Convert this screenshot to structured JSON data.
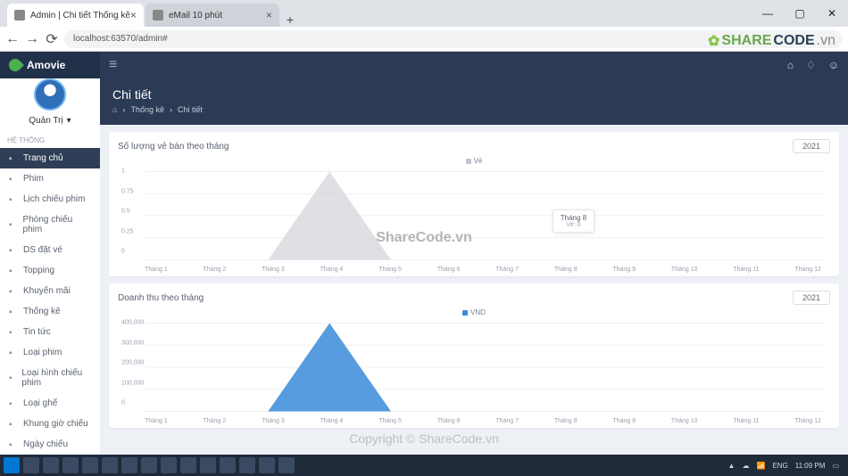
{
  "browser": {
    "tabs": [
      {
        "title": "Admin | Chi tiết Thống kê",
        "active": true
      },
      {
        "title": "eMail 10 phút",
        "active": false
      }
    ],
    "url": "localhost:63570/admin#"
  },
  "window_controls": {
    "min": "—",
    "max": "▢",
    "close": "✕"
  },
  "brand": "Amovie",
  "topbar_icons": [
    "home-icon",
    "bell-icon",
    "user-icon"
  ],
  "profile": {
    "name": "Quản Trị"
  },
  "sidebar": {
    "section": "HỆ THỐNG",
    "items": [
      {
        "label": "Trang chủ",
        "icon": "home-icon",
        "active": true
      },
      {
        "label": "Phim",
        "icon": "film-icon"
      },
      {
        "label": "Lịch chiếu phim",
        "icon": "calendar-icon"
      },
      {
        "label": "Phòng chiếu phim",
        "icon": "room-icon"
      },
      {
        "label": "DS đặt vé",
        "icon": "ticket-icon"
      },
      {
        "label": "Topping",
        "icon": "food-icon"
      },
      {
        "label": "Khuyến mãi",
        "icon": "promo-icon"
      },
      {
        "label": "Thống kê",
        "icon": "stats-icon"
      },
      {
        "label": "Tin tức",
        "icon": "news-icon"
      },
      {
        "label": "Loại phim",
        "icon": "tag-icon"
      },
      {
        "label": "Loại hình chiếu phim",
        "icon": "tag-icon"
      },
      {
        "label": "Loại ghế",
        "icon": "seat-icon"
      },
      {
        "label": "Khung giờ chiếu",
        "icon": "clock-icon"
      },
      {
        "label": "Ngày chiếu",
        "icon": "date-icon"
      }
    ]
  },
  "page": {
    "title": "Chi tiết",
    "breadcrumb": [
      "⌂",
      "Thống kê",
      "Chi tiết"
    ]
  },
  "cards": {
    "tickets": {
      "title": "Số lượng vẻ bán theo tháng",
      "year": "2021",
      "legend": "Vé"
    },
    "revenue": {
      "title": "Doanh thu theo tháng",
      "year": "2021",
      "legend": "VND"
    }
  },
  "tooltip": {
    "title": "Tháng 8",
    "value": "Vé: 0"
  },
  "watermarks": {
    "logo_a": "SHARE",
    "logo_b": "CODE",
    "logo_c": ".vn",
    "center": "ShareCode.vn",
    "bottom": "Copyright © ShareCode.vn"
  },
  "taskbar": {
    "lang": "ENG",
    "time": "11:09 PM"
  },
  "chart_data": [
    {
      "type": "area",
      "title": "Số lượng vẻ bán theo tháng",
      "series_name": "Vé",
      "categories": [
        "Tháng 1",
        "Tháng 2",
        "Tháng 3",
        "Tháng 4",
        "Tháng 5",
        "Tháng 6",
        "Tháng 7",
        "Tháng 8",
        "Tháng 9",
        "Tháng 10",
        "Tháng 11",
        "Tháng 12"
      ],
      "values": [
        0,
        0,
        0,
        1,
        0,
        0,
        0,
        0,
        0,
        0,
        0,
        0
      ],
      "yticks": [
        0,
        0.25,
        0.5,
        0.75,
        1
      ],
      "ylim": [
        0,
        1
      ],
      "color": "#c9ccd1"
    },
    {
      "type": "area",
      "title": "Doanh thu theo tháng",
      "series_name": "VND",
      "categories": [
        "Tháng 1",
        "Tháng 2",
        "Tháng 3",
        "Tháng 4",
        "Tháng 5",
        "Tháng 6",
        "Tháng 7",
        "Tháng 8",
        "Tháng 9",
        "Tháng 10",
        "Tháng 11",
        "Tháng 12"
      ],
      "values": [
        0,
        0,
        0,
        400000,
        0,
        0,
        0,
        0,
        0,
        0,
        0,
        0
      ],
      "yticks": [
        0,
        100000,
        200000,
        300000,
        400000
      ],
      "ylim": [
        0,
        400000
      ],
      "color": "#3a8bd8"
    }
  ]
}
